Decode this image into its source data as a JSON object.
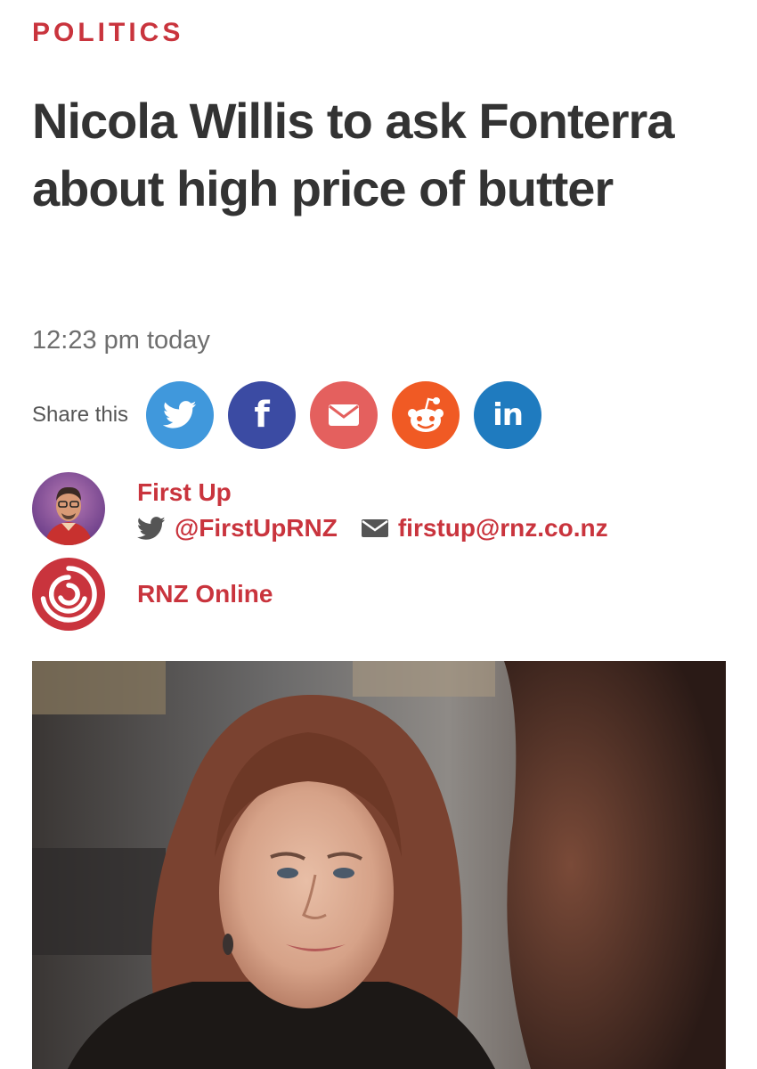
{
  "article": {
    "section": "POLITICS",
    "headline": "Nicola Willis to ask Fonterra about high price of butter",
    "timestamp": "12:23 pm today"
  },
  "share": {
    "label": "Share this",
    "buttons": [
      {
        "network": "twitter",
        "icon": "twitter-bird-icon",
        "color": "#4098dc"
      },
      {
        "network": "facebook",
        "icon": "facebook-f-icon",
        "glyph": "f",
        "color": "#3b4ba3"
      },
      {
        "network": "email",
        "icon": "envelope-icon",
        "color": "#e4605e"
      },
      {
        "network": "reddit",
        "icon": "reddit-alien-icon",
        "color": "#f05a24"
      },
      {
        "network": "linkedin",
        "icon": "linkedin-in-icon",
        "glyph": "in",
        "color": "#1f7bbf"
      }
    ]
  },
  "author": {
    "name": "First Up",
    "twitter_handle": "@FirstUpRNZ",
    "email": "firstup@rnz.co.nz"
  },
  "organization": {
    "name": "RNZ Online"
  },
  "colors": {
    "accent": "#c9343d",
    "headline": "#333333",
    "muted": "#6e6e6e"
  }
}
